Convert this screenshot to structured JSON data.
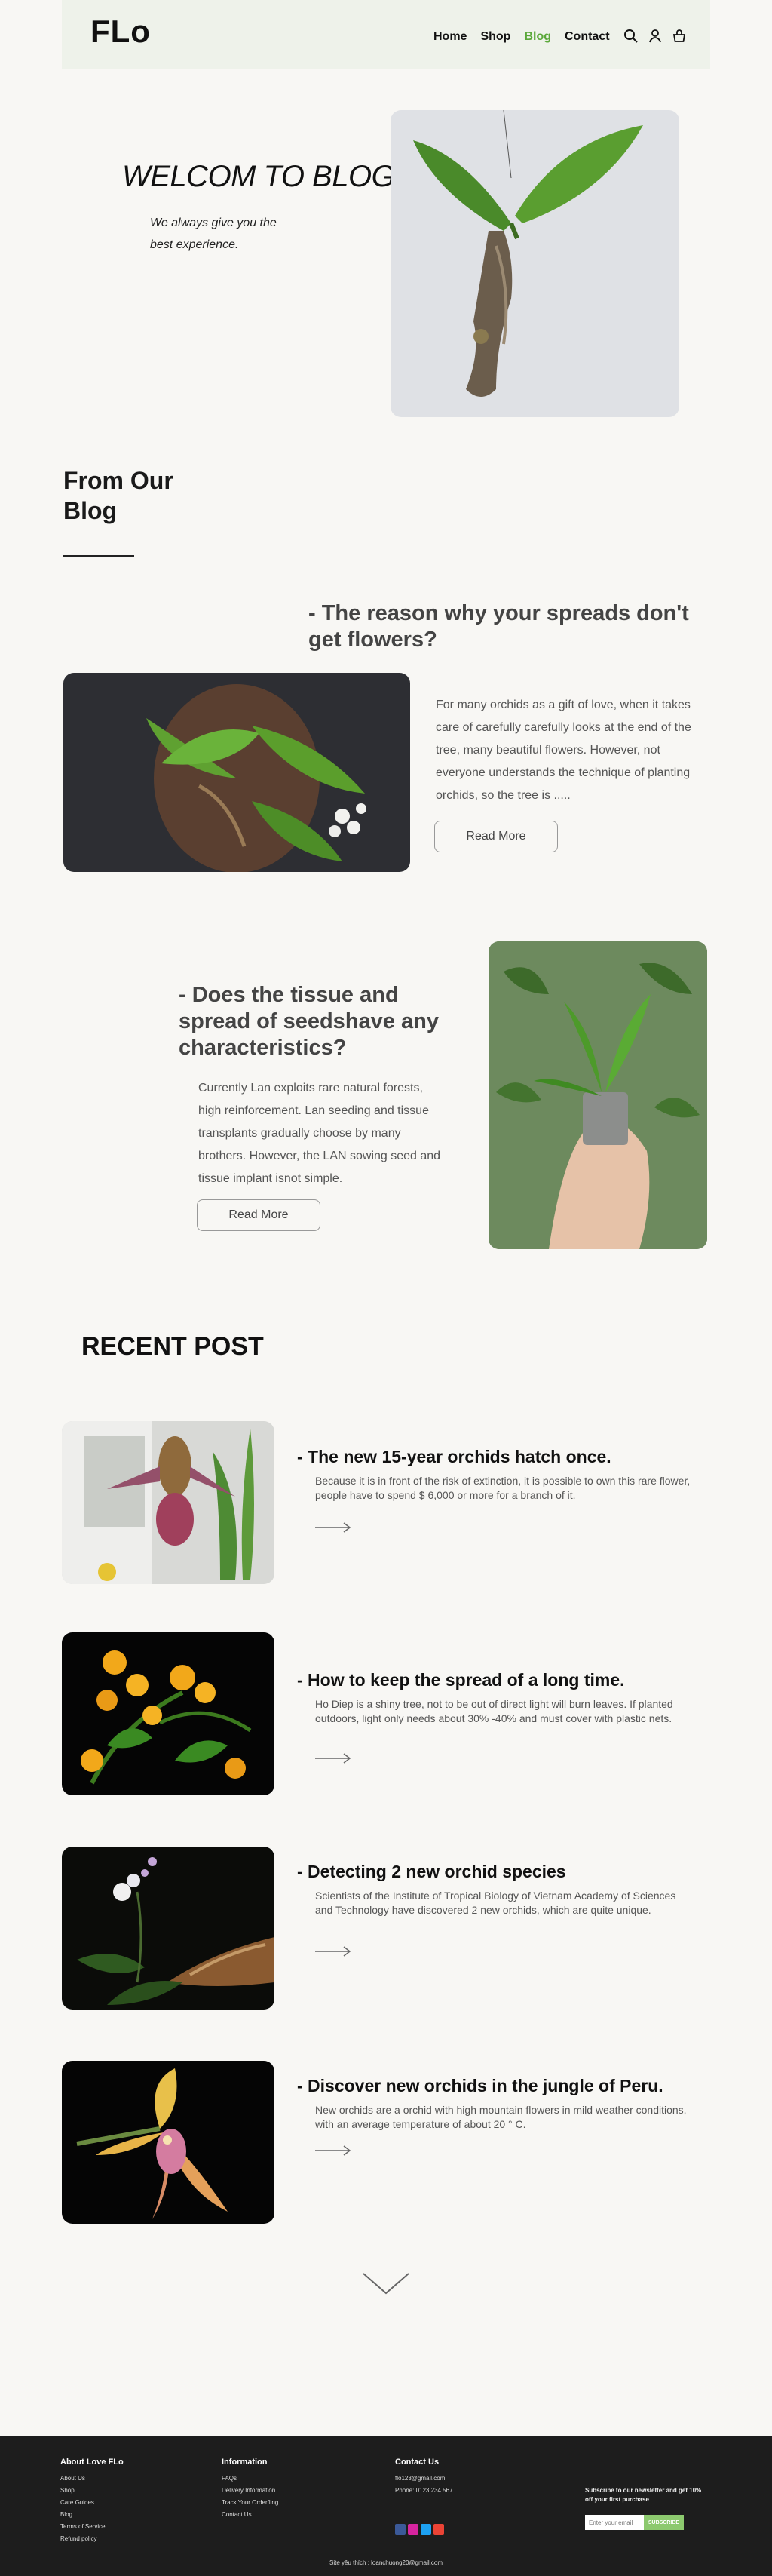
{
  "header": {
    "logo": "FLo",
    "nav": [
      "Home",
      "Shop",
      "Blog",
      "Contact"
    ],
    "active_nav": "Blog",
    "icons": [
      "search-icon",
      "user-icon",
      "cart-icon"
    ]
  },
  "hero": {
    "title": "WELCOM TO BLOG FLO",
    "subtitle": "We always give you the best experience."
  },
  "blog": {
    "section_title": "From Our Blog",
    "posts": [
      {
        "title": "- The reason why your spreads don't get flowers?",
        "text": "For many orchids as a gift of love, when it takes care of  carefully carefully looks at the end of the tree, many beautiful flowers. However, not everyone understands the technique of planting orchids, so the tree is .....",
        "button": "Read More"
      },
      {
        "title": "- Does the tissue and spread of seedshave any characteristics?",
        "text": "Currently Lan exploits rare natural forests, high reinforcement. Lan seeding and tissue transplants gradually choose by many brothers. However, the LAN sowing seed and tissue implant isnot simple.",
        "button": "Read More"
      }
    ]
  },
  "recent": {
    "title": "RECENT POST",
    "items": [
      {
        "title": "- The new 15-year orchids hatch once.",
        "text": "Because it is in front of the risk of extinction, it is possible to own this rare flower, people have to spend $ 6,000 or more for a branch of it."
      },
      {
        "title": "- How to keep the spread of a long time.",
        "text": "Ho Diep is a shiny tree, not to be out of direct light will burn leaves. If planted outdoors, light only needs about 30% -40% and must cover with plastic nets."
      },
      {
        "title": "- Detecting 2 new orchid species",
        "text": "Scientists of the Institute of Tropical Biology of Vietnam Academy of Sciences and Technology have discovered 2 new orchids, which are quite unique."
      },
      {
        "title": "- Discover new orchids in the jungle of Peru.",
        "text": "New orchids are a orchid with high mountain flowers in mild weather conditions, with an average temperature of about 20 ° C."
      }
    ]
  },
  "footer": {
    "about_title": "About Love FLo",
    "about_links": [
      "About Us",
      "Shop",
      "Care Guides",
      "Blog",
      "Terms of Service",
      "Refund policy"
    ],
    "info_title": "Information",
    "info_links": [
      "FAQs",
      "Delivery Information",
      "Track Your Orderfling",
      "Contact Us"
    ],
    "contact_title": "Contact Us",
    "contact_email": "flo123@gmail.com",
    "contact_phone": "Phone:  0123.234.567",
    "socials": [
      "facebook-icon",
      "instagram-icon",
      "twitter-icon",
      "gmail-icon"
    ],
    "newsletter_text": "Subscribe to our newsletter and get 10% off your first purchase",
    "email_placeholder": "Enter your email",
    "subscribe_label": "SUBSCRIBE",
    "copyright": "Site yêu thích :   loanchuong20@gmail.com"
  },
  "colors": {
    "background": "#f8f7f4",
    "header_bg": "#eef2ea",
    "accent_green": "#5aa83a",
    "footer_bg": "#1d1d1d",
    "subscribe_bg": "#8cc96e"
  }
}
